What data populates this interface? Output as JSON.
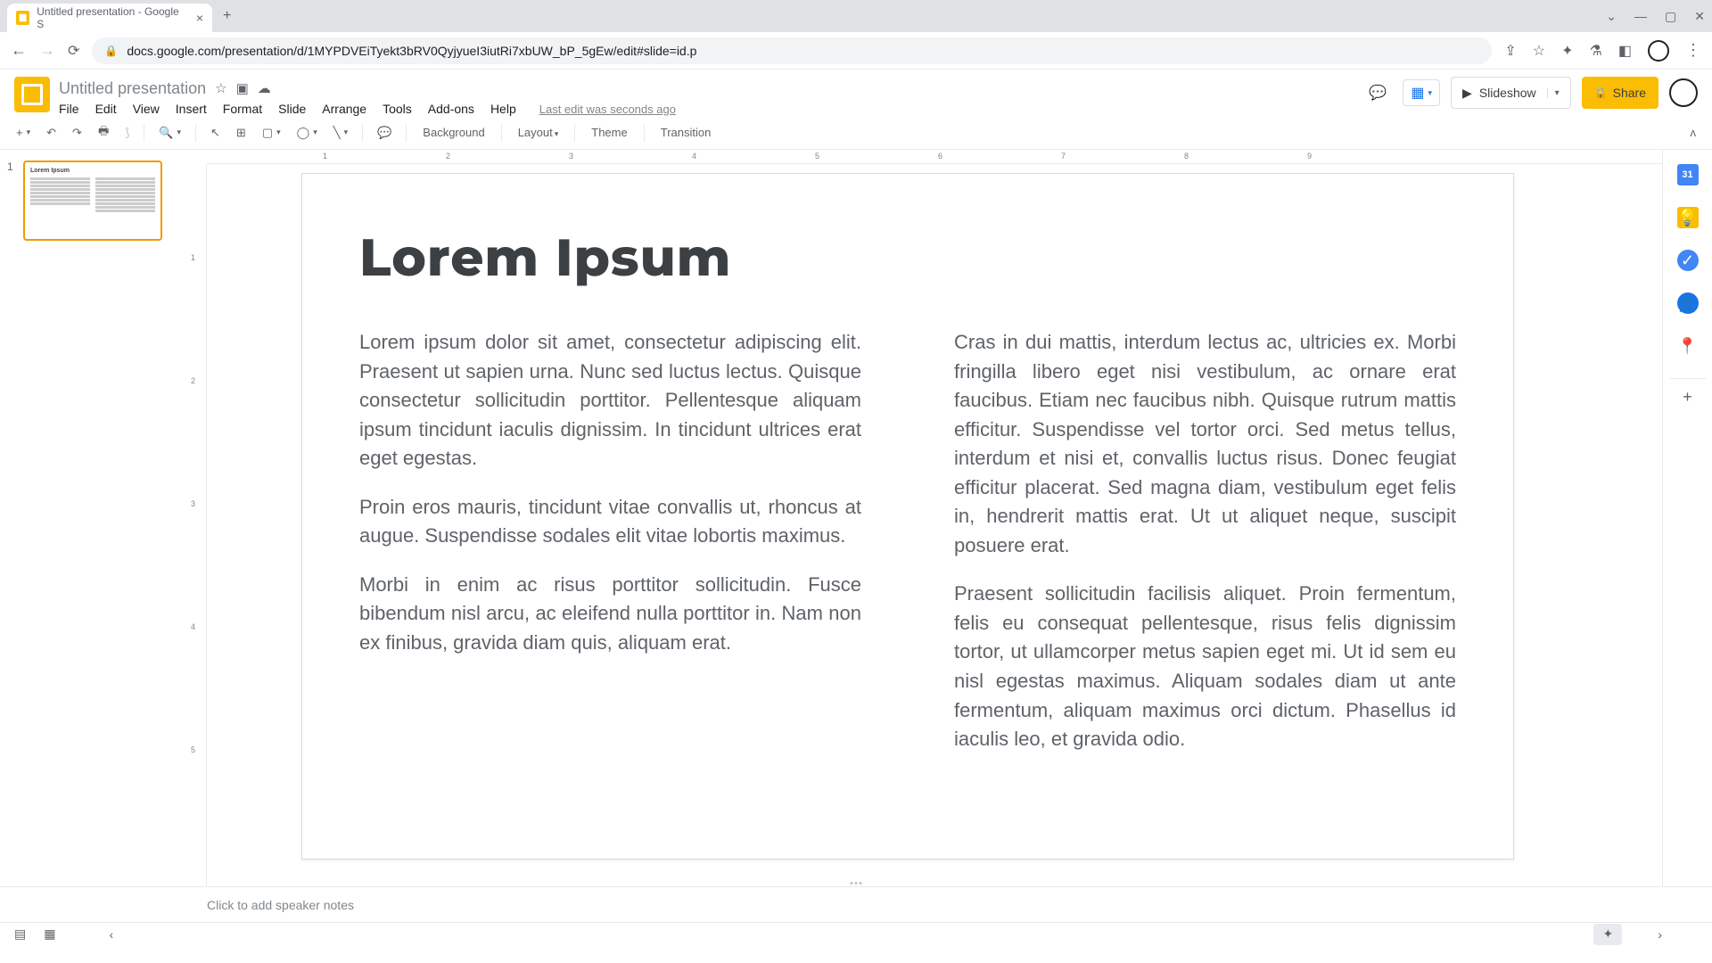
{
  "browser": {
    "tab_title": "Untitled presentation - Google S",
    "url": "docs.google.com/presentation/d/1MYPDVEiTyekt3bRV0QyjyueI3iutRi7xbUW_bP_5gEw/edit#slide=id.p"
  },
  "header": {
    "doc_title": "Untitled presentation",
    "menus": [
      "File",
      "Edit",
      "View",
      "Insert",
      "Format",
      "Slide",
      "Arrange",
      "Tools",
      "Add-ons",
      "Help"
    ],
    "last_edit": "Last edit was seconds ago",
    "slideshow_label": "Slideshow",
    "share_label": "Share"
  },
  "toolbar": {
    "background": "Background",
    "layout": "Layout",
    "theme": "Theme",
    "transition": "Transition"
  },
  "ruler_h": [
    "1",
    "2",
    "3",
    "4",
    "5",
    "6",
    "7",
    "8",
    "9"
  ],
  "ruler_v": [
    "1",
    "2",
    "3",
    "4",
    "5"
  ],
  "filmstrip": {
    "slides": [
      {
        "num": "1",
        "title": "Lorem Ipsum"
      }
    ]
  },
  "slide": {
    "title": "Lorem Ipsum",
    "left": [
      "Lorem ipsum dolor sit amet, consectetur adipiscing elit. Praesent ut sapien urna. Nunc sed luctus lectus. Quisque consectetur sollicitudin porttitor. Pellentesque aliquam ipsum tincidunt iaculis dignissim. In tincidunt ultrices erat eget egestas.",
      "Proin eros mauris, tincidunt vitae convallis ut, rhoncus at augue. Suspendisse sodales elit vitae lobortis maximus.",
      "Morbi in enim ac risus porttitor sollicitudin. Fusce bibendum nisl arcu, ac eleifend nulla porttitor in. Nam non ex finibus, gravida diam quis, aliquam erat."
    ],
    "right": [
      "Cras in dui mattis, interdum lectus ac, ultricies ex. Morbi fringilla libero eget nisi vestibulum, ac ornare erat faucibus. Etiam nec faucibus nibh. Quisque rutrum mattis efficitur. Suspendisse vel tortor orci. Sed metus tellus, interdum et nisi et, convallis luctus risus. Donec feugiat efficitur placerat. Sed magna diam, vestibulum eget felis in, hendrerit mattis erat. Ut ut aliquet neque, suscipit posuere erat.",
      "Praesent sollicitudin facilisis aliquet. Proin fermentum, felis eu consequat pellentesque, risus felis dignissim tortor, ut ullamcorper metus sapien eget mi. Ut id sem eu nisl egestas maximus. Aliquam sodales diam ut ante fermentum, aliquam maximus orci dictum. Phasellus id iaculis leo, et gravida odio."
    ]
  },
  "notes": {
    "placeholder": "Click to add speaker notes"
  }
}
